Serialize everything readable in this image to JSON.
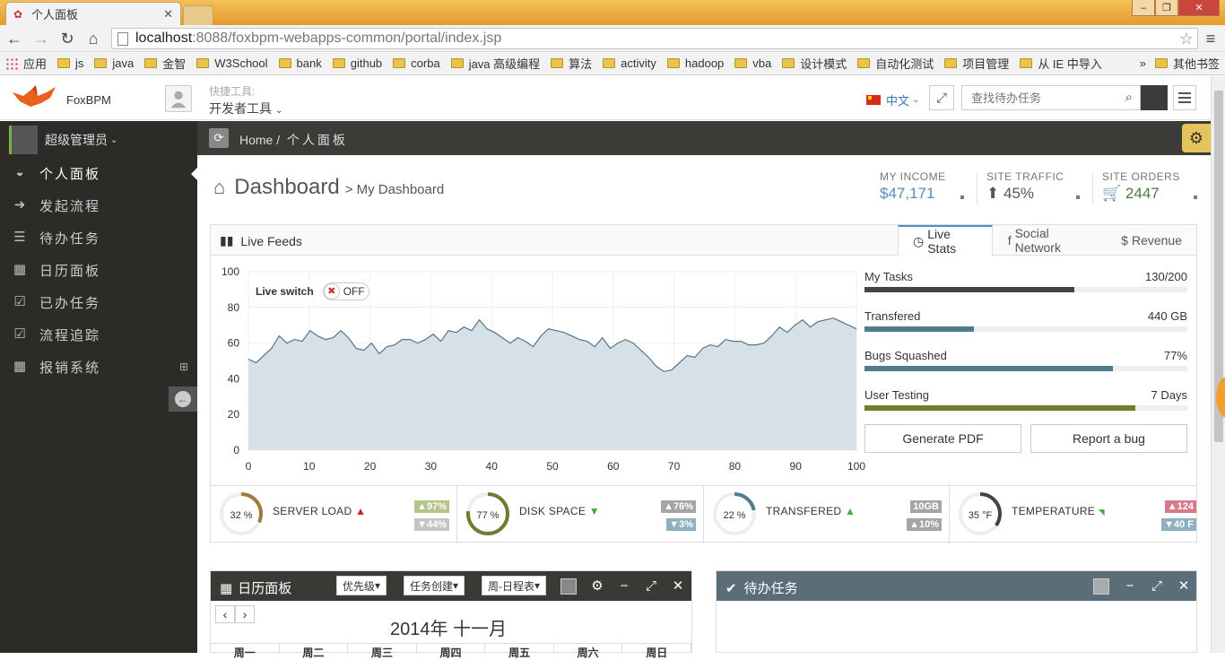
{
  "browser": {
    "tab_title": "个人面板",
    "url_host": "localhost",
    "url_path": ":8088/foxbpm-webapps-common/portal/index.jsp",
    "bookmarks": [
      "应用",
      "js",
      "java",
      "金智",
      "W3School",
      "bank",
      "github",
      "corba",
      "java 高级编程",
      "算法",
      "activity",
      "hadoop",
      "vba",
      "设计模式",
      "自动化测试",
      "项目管理",
      "从 IE 中导入"
    ],
    "bookmarks_more": "»",
    "other_bookmarks": "其他书签"
  },
  "header": {
    "logo_text": "FoxBPM",
    "quick_label": "快捷工具:",
    "quick_value": "开发者工具",
    "language": "中文",
    "search_placeholder": "查找待办任务"
  },
  "sidebar": {
    "user": "超级管理员",
    "items": [
      {
        "label": "个人面板",
        "icon": "dashboard-icon"
      },
      {
        "label": "发起流程",
        "icon": "arrow-circle-icon"
      },
      {
        "label": "待办任务",
        "icon": "tasks-icon"
      },
      {
        "label": "日历面板",
        "icon": "calendar-icon"
      },
      {
        "label": "已办任务",
        "icon": "check-square-icon"
      },
      {
        "label": "流程追踪",
        "icon": "check-square-icon"
      },
      {
        "label": "报销系统",
        "icon": "calendar-icon"
      }
    ]
  },
  "breadcrumb": {
    "home": "Home /",
    "current": "个人面板"
  },
  "dashboard": {
    "title": "Dashboard",
    "subtitle": "> My Dashboard",
    "stats": [
      {
        "label": "MY INCOME",
        "value": "$47,171",
        "color": "#5b8bb5"
      },
      {
        "label": "SITE TRAFFIC",
        "value": "45%",
        "color": "#555555"
      },
      {
        "label": "SITE ORDERS",
        "value": "2447",
        "color": "#4c7b3a"
      }
    ]
  },
  "widget": {
    "title": "Live Feeds",
    "tabs": [
      "Live Stats",
      "Social Network",
      "Revenue"
    ],
    "live_switch": "Live switch",
    "switch_state": "OFF",
    "progress": [
      {
        "label": "My Tasks",
        "value": "130/200",
        "fraction": 0.65,
        "color": "#444444"
      },
      {
        "label": "Transfered",
        "value": "440 GB",
        "fraction": 0.34,
        "color": "#4f7d8e"
      },
      {
        "label": "Bugs Squashed",
        "value": "77%",
        "fraction": 0.77,
        "color": "#4f7d8e"
      },
      {
        "label": "User Testing",
        "value": "7 Days",
        "fraction": 0.84,
        "color": "#6f7d30"
      }
    ],
    "buttons": [
      "Generate PDF",
      "Report a bug"
    ]
  },
  "chart_data": {
    "type": "area",
    "x_ticks": [
      0,
      10,
      20,
      30,
      40,
      50,
      60,
      70,
      80,
      90,
      100
    ],
    "y_ticks": [
      0,
      20,
      40,
      60,
      80,
      100
    ],
    "ylim": [
      0,
      100
    ],
    "xlim": [
      0,
      100
    ],
    "values": [
      51,
      49,
      53,
      57,
      64,
      60,
      62,
      61,
      67,
      64,
      62,
      63,
      67,
      63,
      57,
      56,
      60,
      54,
      58,
      59,
      62,
      62,
      60,
      62,
      65,
      61,
      67,
      66,
      69,
      67,
      73,
      68,
      66,
      63,
      60,
      63,
      61,
      58,
      64,
      68,
      67,
      66,
      64,
      62,
      61,
      58,
      63,
      57,
      60,
      62,
      60,
      56,
      52,
      47,
      44,
      45,
      49,
      53,
      52,
      57,
      59,
      58,
      62,
      61,
      61,
      59,
      59,
      60,
      64,
      69,
      66,
      70,
      73,
      69,
      72,
      73,
      74,
      72,
      70,
      68
    ]
  },
  "infoboxes": [
    {
      "percent": "32 %",
      "name": "SERVER LOAD",
      "trend": "up",
      "trend_color": "#cc2222",
      "mini": [
        "97%",
        "44%"
      ],
      "ring_color": "#a07a3a",
      "fraction": 0.32
    },
    {
      "percent": "77 %",
      "name": "DISK SPACE",
      "trend": "down",
      "trend_color": "#44aa44",
      "mini": [
        "76%",
        "3%"
      ],
      "ring_color": "#6f7d30",
      "fraction": 0.77
    },
    {
      "percent": "22 %",
      "name": "TRANSFERED",
      "trend": "up",
      "trend_color": "#44aa44",
      "mini": [
        "10GB",
        "10%"
      ],
      "ring_color": "#4f7d8e",
      "fraction": 0.22
    },
    {
      "percent": "35 °F",
      "name": "TEMPERATURE",
      "trend": "down",
      "trend_color": "#44aa44",
      "mini": [
        "124",
        "40 F"
      ],
      "ring_color": "#444444",
      "fraction": 0.35
    }
  ],
  "calendar": {
    "title": "日历面板",
    "filters": [
      "优先级",
      "任务创建",
      "周-日程表"
    ],
    "month": "2014年 十一月",
    "weekdays": [
      "周一",
      "周二",
      "周三",
      "周四",
      "周五",
      "周六",
      "周日"
    ]
  },
  "todo": {
    "title": "待办任务"
  }
}
